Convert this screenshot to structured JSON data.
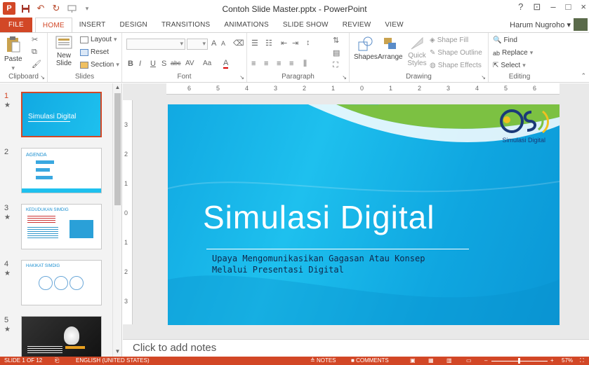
{
  "window": {
    "title": "Contoh Slide Master.pptx - PowerPoint",
    "help": "?",
    "minimize": "–",
    "maximize": "□",
    "close": "×"
  },
  "tabs": [
    "FILE",
    "HOME",
    "INSERT",
    "DESIGN",
    "TRANSITIONS",
    "ANIMATIONS",
    "SLIDE SHOW",
    "REVIEW",
    "VIEW"
  ],
  "active_tab": "HOME",
  "user": {
    "name": "Harum Nugroho",
    "caret": "▾"
  },
  "ribbon": {
    "clipboard": {
      "label": "Clipboard",
      "paste": "Paste"
    },
    "slides": {
      "label": "Slides",
      "new_slide": "New Slide",
      "layout": "Layout",
      "reset": "Reset",
      "section": "Section"
    },
    "font": {
      "label": "Font",
      "bold": "B",
      "italic": "I",
      "underline": "U",
      "shadow": "S",
      "strike": "abc",
      "spacing": "AV",
      "case": "Aa",
      "color": "A",
      "grow": "A",
      "shrink": "A"
    },
    "paragraph": {
      "label": "Paragraph"
    },
    "drawing": {
      "label": "Drawing",
      "shapes": "Shapes",
      "arrange": "Arrange",
      "quick_styles": "Quick Styles",
      "fill": "Shape Fill",
      "outline": "Shape Outline",
      "effects": "Shape Effects"
    },
    "editing": {
      "label": "Editing",
      "find": "Find",
      "replace": "Replace",
      "select": "Select"
    }
  },
  "thumbnails": [
    {
      "num": "1",
      "star": "★",
      "title": "Simulasi Digital",
      "selected": true
    },
    {
      "num": "2",
      "star": "",
      "title": "AGENDA",
      "selected": false
    },
    {
      "num": "3",
      "star": "★",
      "title": "KEDUDUKAN SIMDIG",
      "selected": false
    },
    {
      "num": "4",
      "star": "★",
      "title": "HAKIKAT SIMDIG",
      "selected": false
    },
    {
      "num": "5",
      "star": "★",
      "title": "",
      "selected": false
    }
  ],
  "ruler": {
    "h": [
      "6",
      "5",
      "4",
      "3",
      "2",
      "1",
      "0",
      "1",
      "2",
      "3",
      "4",
      "5",
      "6"
    ],
    "v": [
      "3",
      "2",
      "1",
      "0",
      "1",
      "2",
      "3"
    ]
  },
  "slide": {
    "title": "Simulasi Digital",
    "subtitle_line1": "Upaya Mengomunikasikan Gagasan Atau Konsep",
    "subtitle_line2": "Melalui Presentasi Digital",
    "logo_caption": "Simulasi Digital",
    "colors": {
      "background": "#1ec0ee",
      "accent": "#1b3a78",
      "wave": "#7cc142"
    }
  },
  "notes": {
    "placeholder": "Click to add notes"
  },
  "status": {
    "slide_info": "SLIDE 1 OF 12",
    "language": "ENGLISH (UNITED STATES)",
    "notes": "NOTES",
    "comments": "COMMENTS",
    "zoom": "57%"
  },
  "colors": {
    "brand": "#d24726"
  }
}
